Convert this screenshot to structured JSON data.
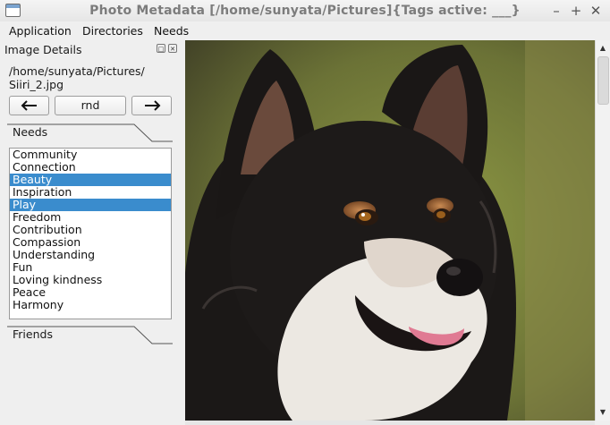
{
  "window": {
    "title": "Photo Metadata [/home/sunyata/Pictures]{Tags active: ___}",
    "minimize_icon": "minimize-icon",
    "maximize_icon": "maximize-icon",
    "close_icon": "close-icon"
  },
  "menu": {
    "application": "Application",
    "directories": "Directories",
    "needs": "Needs"
  },
  "panel": {
    "title": "Image Details",
    "path_line1": "/home/sunyata/Pictures/",
    "path_line2": "Siiri_2.jpg",
    "prev_icon": "arrow-left-icon",
    "random_label": "rnd",
    "next_icon": "arrow-right-icon",
    "needs_tab": "Needs",
    "friends_tab": "Friends",
    "needs_items": [
      {
        "label": "Community",
        "selected": false
      },
      {
        "label": "Connection",
        "selected": false
      },
      {
        "label": "Beauty",
        "selected": true
      },
      {
        "label": "Inspiration",
        "selected": false
      },
      {
        "label": "Play",
        "selected": true
      },
      {
        "label": "Freedom",
        "selected": false
      },
      {
        "label": "Contribution",
        "selected": false
      },
      {
        "label": "Compassion",
        "selected": false
      },
      {
        "label": "Understanding",
        "selected": false
      },
      {
        "label": "Fun",
        "selected": false
      },
      {
        "label": "Loving kindness",
        "selected": false
      },
      {
        "label": "Peace",
        "selected": false
      },
      {
        "label": "Harmony",
        "selected": false
      }
    ]
  },
  "image": {
    "subject": "dog-photo"
  },
  "colors": {
    "selection": "#3a8ccd",
    "background": "#efefef"
  }
}
